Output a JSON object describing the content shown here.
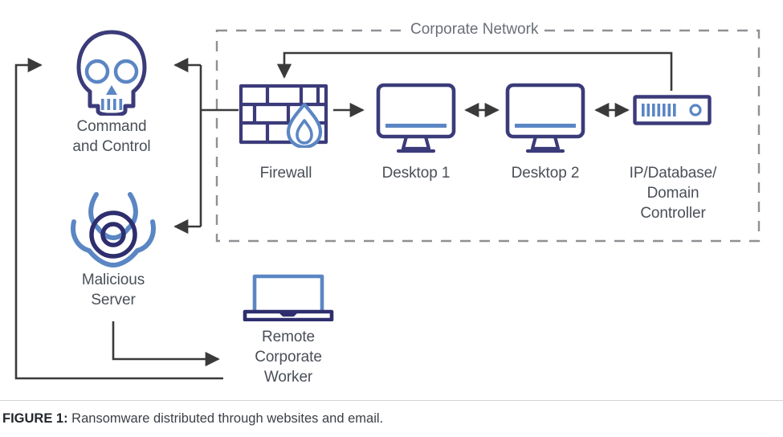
{
  "figure": {
    "caption_prefix": "FIGURE 1:",
    "caption_text": " Ransomware distributed through websites and email."
  },
  "colors": {
    "navy": "#3b3b7a",
    "blue": "#5b86c4",
    "connector": "#3a3a3a",
    "dashed_border": "#8e9094",
    "label_text": "#4a4f57",
    "zone_text": "#6a6f77",
    "background": "#ffffff"
  },
  "zones": [
    {
      "id": "corporate-network",
      "label": "Corporate Network",
      "style": "dashed"
    }
  ],
  "nodes": [
    {
      "id": "command-and-control",
      "label": "Command\nand Control",
      "icon": "skull-icon",
      "zone": "external"
    },
    {
      "id": "malicious-server",
      "label": "Malicious\nServer",
      "icon": "biohazard-icon",
      "zone": "external"
    },
    {
      "id": "firewall",
      "label": "Firewall",
      "icon": "firewall-brick-flame-icon",
      "zone": "corporate-network"
    },
    {
      "id": "desktop-1",
      "label": "Desktop 1",
      "icon": "desktop-monitor-icon",
      "zone": "corporate-network"
    },
    {
      "id": "desktop-2",
      "label": "Desktop 2",
      "icon": "desktop-monitor-icon",
      "zone": "corporate-network"
    },
    {
      "id": "ip-database-domain-controller",
      "label": "IP/Database/\nDomain\nController",
      "icon": "server-rack-icon",
      "zone": "corporate-network"
    },
    {
      "id": "remote-corporate-worker",
      "label": "Remote\nCorporate\nWorker",
      "icon": "laptop-icon",
      "zone": "external"
    }
  ],
  "connections": [
    {
      "id": "server-to-firewall",
      "from": "ip-database-domain-controller",
      "to": "firewall",
      "arrow": "single"
    },
    {
      "id": "firewall-to-desktop-1",
      "from": "firewall",
      "to": "desktop-1",
      "arrow": "single"
    },
    {
      "id": "desktop-1-to-desktop-2",
      "from": "desktop-1",
      "to": "desktop-2",
      "arrow": "double"
    },
    {
      "id": "desktop-2-to-server",
      "from": "desktop-2",
      "to": "ip-database-domain-controller",
      "arrow": "double"
    },
    {
      "id": "firewall-to-command-and-control",
      "from": "firewall",
      "to": "command-and-control",
      "arrow": "single"
    },
    {
      "id": "firewall-to-malicious-server",
      "from": "firewall",
      "to": "malicious-server",
      "arrow": "single"
    },
    {
      "id": "malicious-server-to-remote-worker",
      "from": "malicious-server",
      "to": "remote-corporate-worker",
      "arrow": "single"
    },
    {
      "id": "remote-worker-to-command-and-control",
      "from": "remote-corporate-worker",
      "to": "command-and-control",
      "arrow": "single"
    }
  ]
}
